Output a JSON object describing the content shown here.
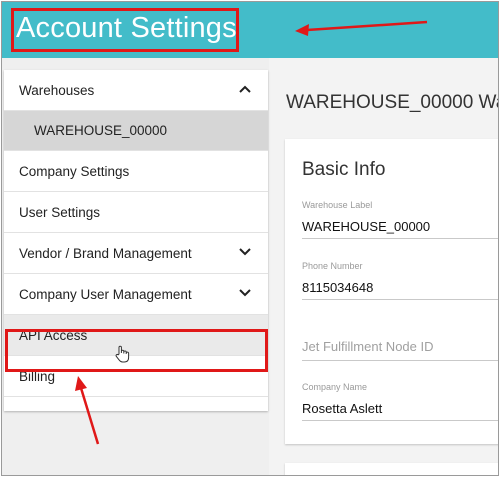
{
  "header": {
    "title": "Account Settings",
    "background": "#43bcc9"
  },
  "sidebar": {
    "items": [
      {
        "label": "Warehouses",
        "icon": "chevron-up-icon"
      },
      {
        "label": "WAREHOUSE_00000"
      },
      {
        "label": "Company Settings"
      },
      {
        "label": "User Settings"
      },
      {
        "label": "Vendor / Brand Management",
        "icon": "chevron-down-icon"
      },
      {
        "label": "Company User Management",
        "icon": "chevron-down-icon"
      },
      {
        "label": "API Access"
      },
      {
        "label": "Billing"
      }
    ]
  },
  "main": {
    "page_title": "WAREHOUSE_00000 Wa",
    "card": {
      "title": "Basic Info",
      "fields": [
        {
          "label": "Warehouse Label",
          "value": "WAREHOUSE_00000"
        },
        {
          "label": "Phone Number",
          "value": "8115034648"
        },
        {
          "placeholder": "Jet Fulfillment Node ID"
        },
        {
          "label": "Company Name",
          "value": "Rosetta Aslett"
        }
      ]
    }
  },
  "annotations": {
    "highlight_color": "#e01818"
  }
}
